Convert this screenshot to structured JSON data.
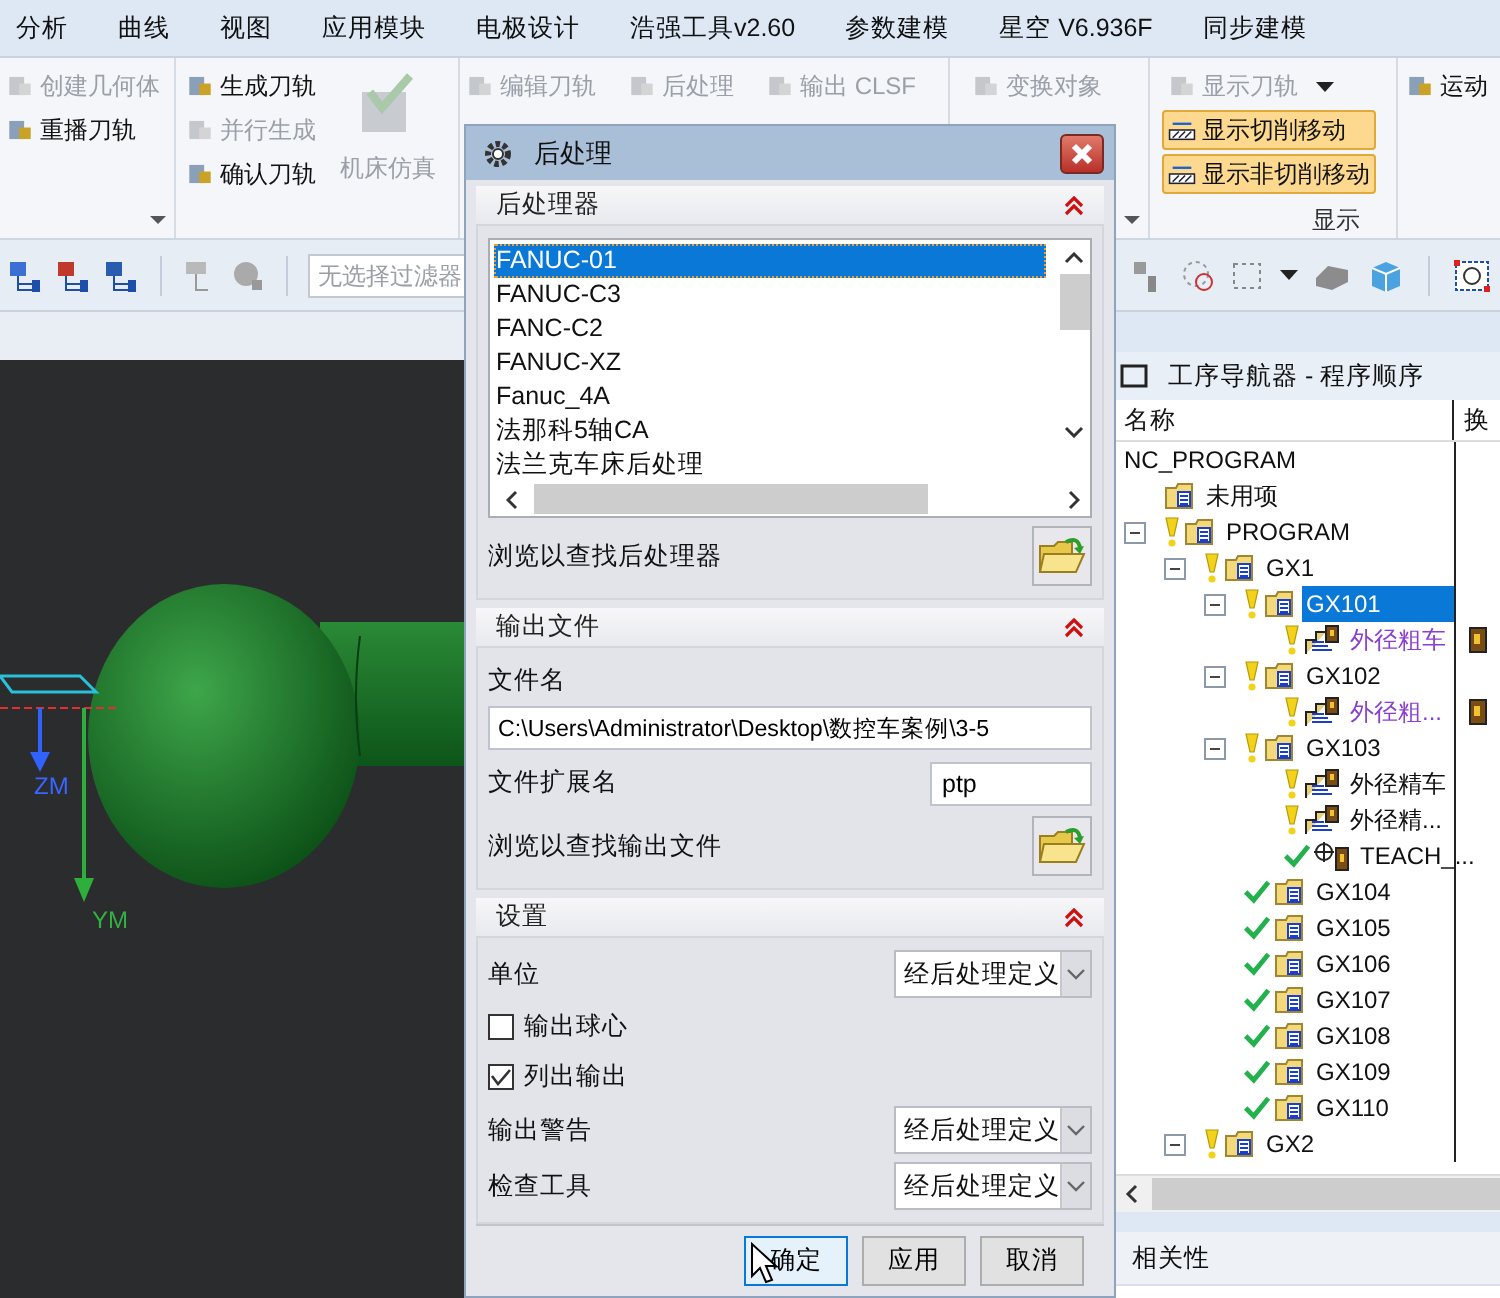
{
  "menu": [
    "分析",
    "曲线",
    "视图",
    "应用模块",
    "电极设计",
    "浩强工具v2.60",
    "参数建模",
    "星空 V6.936F",
    "同步建模"
  ],
  "ribbon": {
    "groups": [
      {
        "launcher": true,
        "columns": [
          [
            {
              "label": "创建几何体",
              "kind": "small",
              "disabled": true
            },
            {
              "label": "重播刀轨",
              "kind": "small",
              "disabled": false
            }
          ]
        ]
      },
      {
        "columns": [
          [
            {
              "label": "生成刀轨",
              "kind": "small",
              "disabled": false
            },
            {
              "label": "并行生成",
              "kind": "small",
              "disabled": true
            },
            {
              "label": "确认刀轨",
              "kind": "small",
              "disabled": false
            }
          ],
          [
            {
              "label": "机床仿真",
              "kind": "large",
              "disabled": true
            }
          ]
        ]
      },
      {
        "columns": [
          [
            {
              "label": "编辑刀轨",
              "kind": "small",
              "disabled": true
            }
          ],
          [
            {
              "label": "后处理",
              "kind": "small",
              "disabled": true
            }
          ],
          [
            {
              "label": "输出 CLSF",
              "kind": "small",
              "disabled": true
            }
          ]
        ]
      },
      {
        "launcher": true,
        "columns": [
          [
            {
              "label": "变换对象",
              "kind": "small",
              "disabled": true
            }
          ]
        ]
      },
      {
        "label": "显示",
        "columns": [
          [
            {
              "label": "显示刀轨",
              "kind": "dropdown",
              "disabled": true
            },
            {
              "label": "显示切削移动",
              "kind": "toggle",
              "on": true
            },
            {
              "label": "显示非切削移动",
              "kind": "toggle",
              "on": true
            }
          ]
        ]
      },
      {
        "columns": [
          [
            {
              "label": "运动",
              "kind": "small",
              "disabled": false
            }
          ]
        ]
      }
    ]
  },
  "toolbar": {
    "filter": {
      "placeholder": "无选择过滤器"
    }
  },
  "viewport": {
    "axes": [
      {
        "label": "ZM"
      },
      {
        "label": "YM"
      }
    ]
  },
  "navigator": {
    "title": "工序导航器 - 程序顺序",
    "columns": [
      "名称",
      "换"
    ],
    "tree": [
      {
        "label": "NC_PROGRAM",
        "children": [
          {
            "label": "未用项",
            "kind": "group"
          },
          {
            "label": "PROGRAM",
            "kind": "group",
            "complete": false,
            "expanded": true,
            "children": [
              {
                "label": "GX1",
                "kind": "group",
                "complete": false,
                "expanded": true,
                "children": [
                  {
                    "label": "GX101",
                    "kind": "group",
                    "complete": false,
                    "expanded": true,
                    "selected": true,
                    "children": [
                      {
                        "label": "外径粗车",
                        "kind": "operation",
                        "complete": false,
                        "color": "#8a3fd0",
                        "tool": true,
                        "selected": false
                      }
                    ]
                  },
                  {
                    "label": "GX102",
                    "kind": "group",
                    "complete": false,
                    "expanded": true,
                    "selected": false,
                    "children": [
                      {
                        "label": "外径粗...",
                        "kind": "operation",
                        "complete": false,
                        "color": "#8a3fd0",
                        "tool": true,
                        "selected": false
                      }
                    ]
                  },
                  {
                    "label": "GX103",
                    "kind": "group",
                    "complete": false,
                    "expanded": true,
                    "selected": false,
                    "children": [
                      {
                        "label": "外径精车",
                        "kind": "operation",
                        "complete": false,
                        "selected": false
                      },
                      {
                        "label": "外径精...",
                        "kind": "operation",
                        "complete": false,
                        "selected": false
                      },
                      {
                        "label": "TEACH_...",
                        "kind": "teach",
                        "complete": true,
                        "selected": false
                      }
                    ]
                  },
                  {
                    "label": "GX104",
                    "kind": "group",
                    "complete": true,
                    "selected": false
                  },
                  {
                    "label": "GX105",
                    "kind": "group",
                    "complete": true,
                    "selected": false
                  },
                  {
                    "label": "GX106",
                    "kind": "group",
                    "complete": true,
                    "selected": false
                  },
                  {
                    "label": "GX107",
                    "kind": "group",
                    "complete": true,
                    "selected": false
                  },
                  {
                    "label": "GX108",
                    "kind": "group",
                    "complete": true,
                    "selected": false
                  },
                  {
                    "label": "GX109",
                    "kind": "group",
                    "complete": true,
                    "selected": false
                  },
                  {
                    "label": "GX110",
                    "kind": "group",
                    "complete": true,
                    "selected": false
                  }
                ]
              },
              {
                "label": "GX2",
                "kind": "group",
                "complete": false,
                "expanded": true,
                "selected": false
              }
            ]
          }
        ]
      }
    ],
    "footer": "相关性"
  },
  "dialog": {
    "title": "后处理",
    "sections": [
      {
        "kind": "list",
        "title": "后处理器",
        "expanded": true,
        "items": [
          {
            "label": "FANUC-01",
            "selected": true
          },
          {
            "label": "FANUC-C3",
            "selected": false
          },
          {
            "label": "FANC-C2",
            "selected": false
          },
          {
            "label": "FANUC-XZ",
            "selected": false
          },
          {
            "label": "Fanuc_4A",
            "selected": false
          },
          {
            "label": "法那科5轴CA",
            "selected": false
          },
          {
            "label": "法兰克车床后处理",
            "selected": false
          }
        ],
        "browse": "浏览以查找后处理器"
      },
      {
        "kind": "file",
        "title": "输出文件",
        "expanded": true,
        "name_label": "文件名",
        "name_value": "C:\\Users\\Administrator\\Desktop\\数控车案例\\3-5",
        "ext_label": "文件扩展名",
        "ext_value": "ptp",
        "browse": "浏览以查找输出文件"
      },
      {
        "kind": "settings",
        "title": "设置",
        "expanded": true,
        "rows": [
          {
            "kind": "select",
            "label": "单位",
            "value": "经后处理定义"
          },
          {
            "kind": "checkbox",
            "label": "输出球心",
            "checked": false
          },
          {
            "kind": "checkbox",
            "label": "列出输出",
            "checked": true
          },
          {
            "kind": "select",
            "label": "输出警告",
            "value": "经后处理定义"
          },
          {
            "kind": "select",
            "label": "检查工具",
            "value": "经后处理定义"
          }
        ]
      }
    ],
    "buttons": [
      {
        "label": "确定",
        "default": true
      },
      {
        "label": "应用",
        "default": false
      },
      {
        "label": "取消",
        "default": false
      }
    ]
  }
}
